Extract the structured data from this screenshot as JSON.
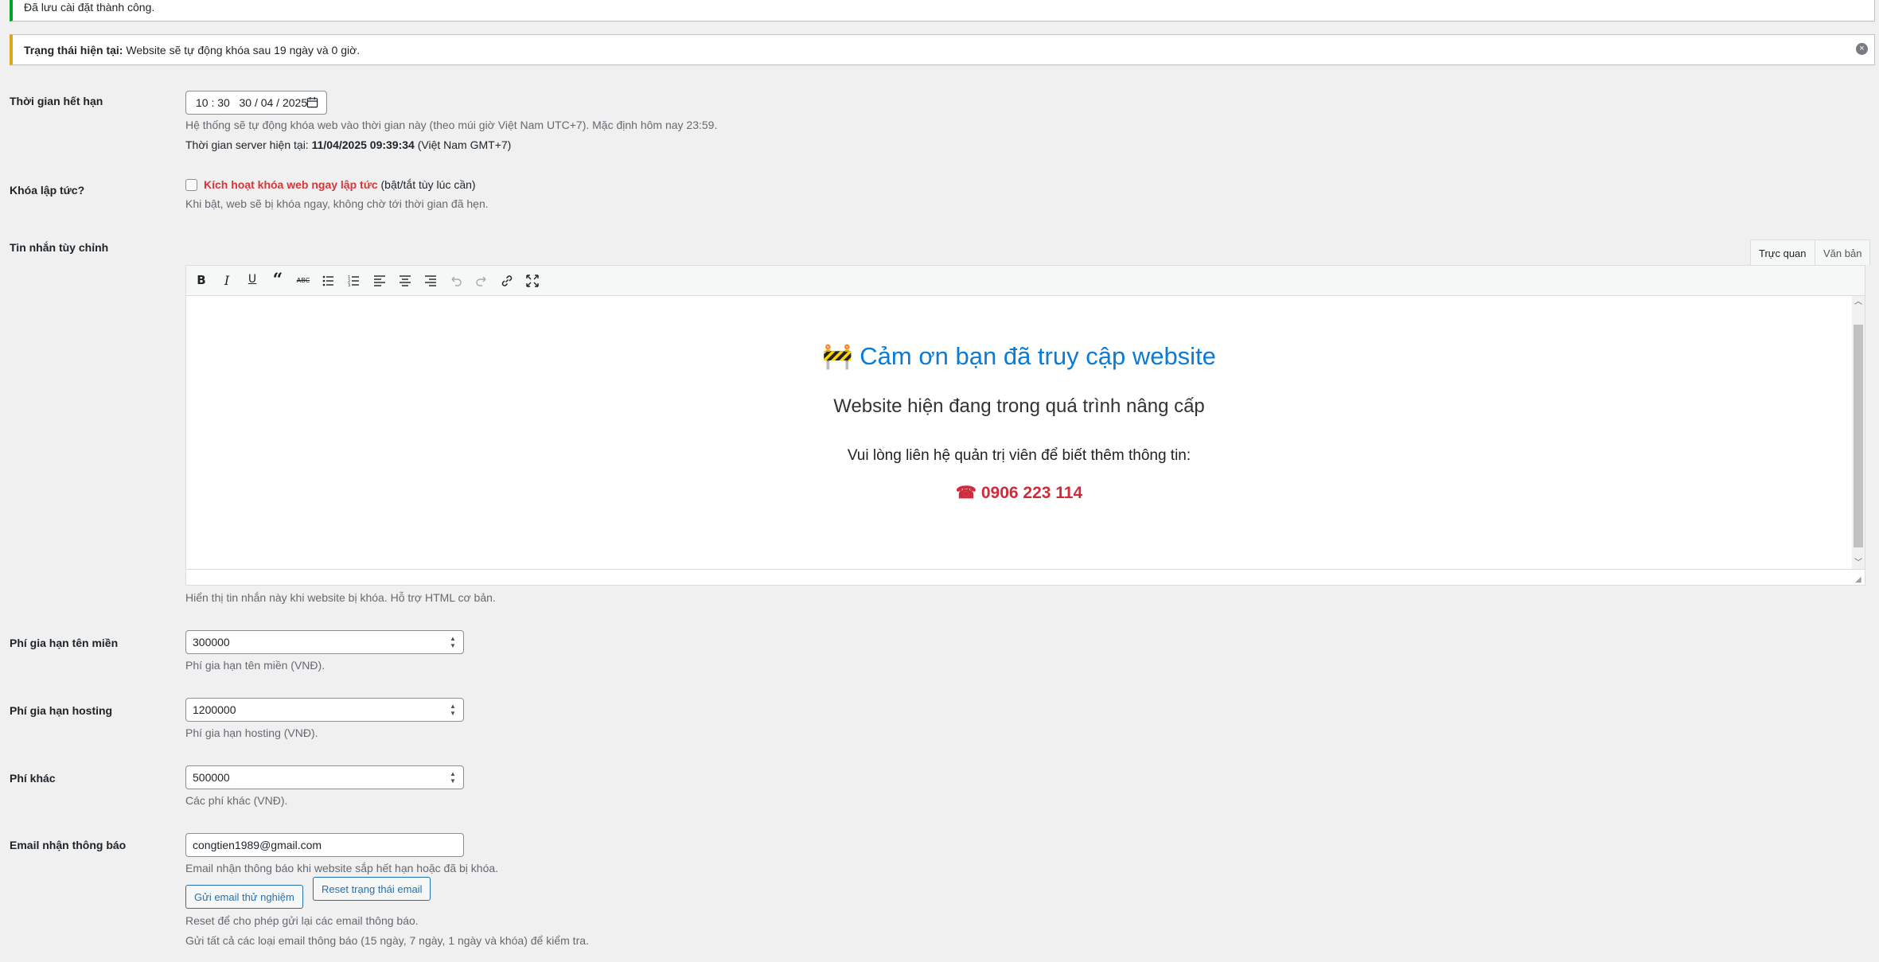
{
  "notices": {
    "success_text": "Đã lưu cài đặt thành công.",
    "status_label": "Trạng thái hiện tại:",
    "status_text": " Website sẽ tự động khóa sau 19 ngày và 0 giờ.",
    "dismiss_glyph": "×"
  },
  "expiry": {
    "label": "Thời gian hết hạn",
    "value": "10 : 30   30 / 04 / 2025",
    "desc": "Hệ thống sẽ tự động khóa web vào thời gian này (theo múi giờ Việt Nam UTC+7). Mặc định hôm nay 23:59.",
    "server_prefix": "Thời gian server hiện tại: ",
    "server_time": "11/04/2025 09:39:34",
    "server_suffix": " (Việt Nam GMT+7)"
  },
  "lock_now": {
    "label": "Khóa lập tức?",
    "checked": false,
    "checkbox_label": "Kích hoạt khóa web ngay lập tức",
    "checkbox_suffix": " (bật/tắt tùy lúc cần)",
    "desc": "Khi bật, web sẽ bị khóa ngay, không chờ tới thời gian đã hẹn."
  },
  "message": {
    "label": "Tin nhắn tùy chỉnh",
    "tab_visual": "Trực quan",
    "tab_text": "Văn bản",
    "toolbar_icons": [
      "bold-icon",
      "italic-icon",
      "underline-icon",
      "blockquote-icon",
      "strikethrough-icon",
      "bullet-list-icon",
      "numbered-list-icon",
      "align-left-icon",
      "align-center-icon",
      "align-right-icon",
      "undo-icon",
      "redo-icon",
      "link-icon",
      "fullscreen-icon"
    ],
    "content": {
      "title": "🚧 Cảm ơn bạn đã truy cập website",
      "subtitle": "Website hiện đang trong quá trình nâng cấp",
      "contact": "Vui lòng liên hệ quản trị viên để biết thêm thông tin:",
      "phone": "☎ 0906 223 114"
    },
    "desc": "Hiển thị tin nhắn này khi website bị khóa. Hỗ trợ HTML cơ bản."
  },
  "domain_fee": {
    "label": "Phí gia hạn tên miền",
    "value": "300000",
    "desc": "Phí gia hạn tên miền (VNĐ)."
  },
  "hosting_fee": {
    "label": "Phí gia hạn hosting",
    "value": "1200000",
    "desc": "Phí gia hạn hosting (VNĐ)."
  },
  "other_fee": {
    "label": "Phí khác",
    "value": "500000",
    "desc": "Các phí khác (VNĐ)."
  },
  "email": {
    "label": "Email nhận thông báo",
    "value": "congtien1989@gmail.com",
    "desc": "Email nhận thông báo khi website sắp hết hạn hoặc đã bị khóa.",
    "test_button": "Gửi email thử nghiệm",
    "reset_button": "Reset trạng thái email",
    "reset_desc": "Reset để cho phép gửi lại các email thông báo.",
    "test_desc": "Gửi tất cả các loại email thông báo (15 ngày, 7 ngày, 1 ngày và khóa) để kiểm tra."
  },
  "colors": {
    "success": "#00a32a",
    "warning": "#dba617",
    "link_blue": "#2271b1",
    "title_blue": "#0b7bd6",
    "phone_red": "#d12a3a",
    "danger_red": "#d63638"
  }
}
